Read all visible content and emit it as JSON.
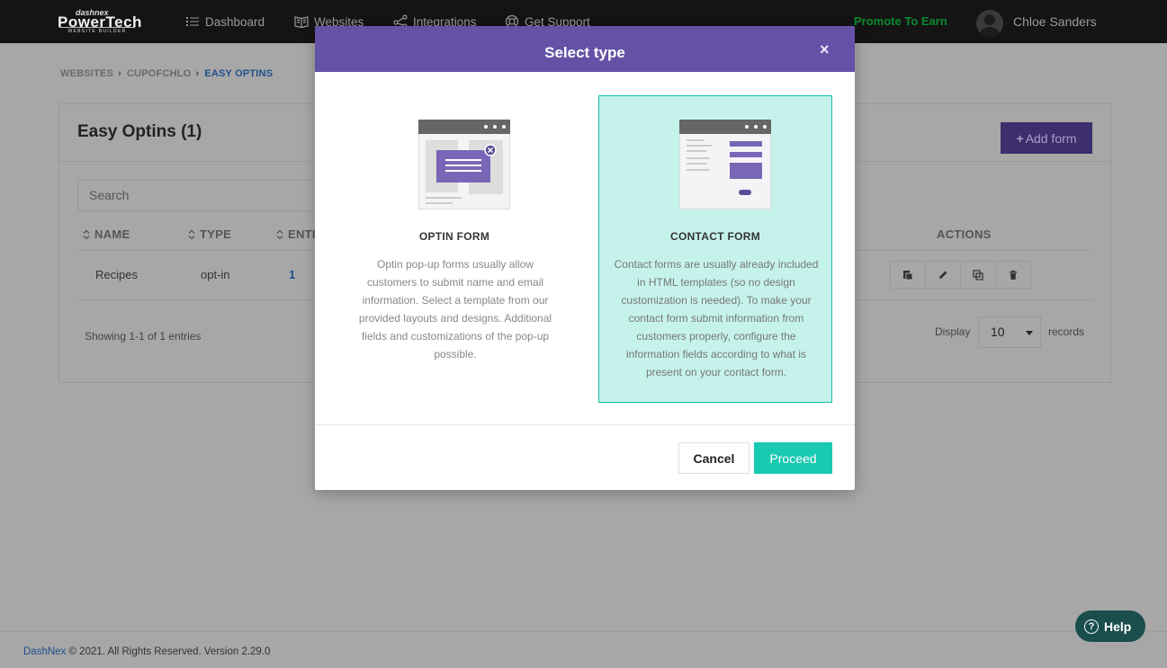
{
  "navbar": {
    "logo": {
      "line1": "dashnex",
      "line2": "PowerTech",
      "line3": "WEBSITE BUILDER"
    },
    "items": [
      {
        "label": "Dashboard",
        "icon": "list-icon"
      },
      {
        "label": "Websites",
        "icon": "book-icon"
      },
      {
        "label": "Integrations",
        "icon": "share-icon"
      },
      {
        "label": "Get Support",
        "icon": "lifebuoy-icon"
      }
    ],
    "promote": "Promote To Earn",
    "user_name": "Chloe Sanders"
  },
  "breadcrumb": [
    "WEBSITES",
    "CUPOFCHLO",
    "EASY OPTINS"
  ],
  "panel": {
    "title": "Easy Optins (1)",
    "add_button": "Add form",
    "search_placeholder": "Search",
    "columns": [
      "NAME",
      "TYPE",
      "ENTI",
      "ACTIONS"
    ],
    "rows": [
      {
        "name": "Recipes",
        "type": "opt-in",
        "entries": "1"
      }
    ],
    "showing": "Showing 1-1 of 1 entries",
    "display_label": "Display",
    "display_value": "10",
    "records_label": "records"
  },
  "modal": {
    "title": "Select type",
    "close": "×",
    "options": [
      {
        "title": "OPTIN FORM",
        "description": "Optin pop-up forms usually allow customers to submit name and email information. Select a template from our provided layouts and designs. Additional fields and customizations of the pop-up possible.",
        "selected": false
      },
      {
        "title": "CONTACT FORM",
        "description": "Contact forms are usually already included in HTML templates (so no design customization is needed). To make your contact form submit information from customers properly, configure the information fields according to what is present on your contact form.",
        "selected": true
      }
    ],
    "cancel": "Cancel",
    "proceed": "Proceed"
  },
  "footer": {
    "brand": "DashNex",
    "text": " © 2021. All Rights Reserved. Version 2.29.0"
  },
  "help": "Help",
  "colors": {
    "navbar": "#141414",
    "modal_header": "#6452a6",
    "selected_card_bg": "#c6f2ec",
    "selected_card_border": "#15bda6",
    "proceed": "#19c9b1",
    "promote": "#0c8a2f",
    "overlay": "#a7a7a7"
  }
}
